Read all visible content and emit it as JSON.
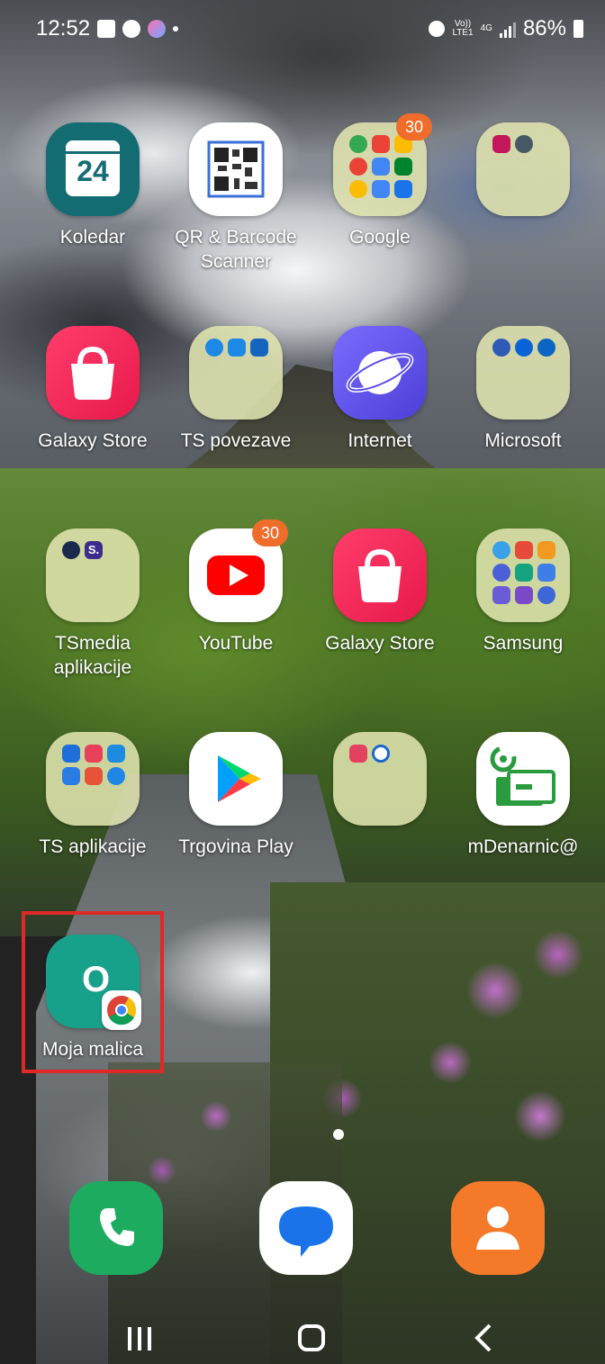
{
  "status_bar": {
    "time": "12:52",
    "network_top": "Vo))",
    "network_bottom": "LTE1",
    "network_type": "4G",
    "battery": "86%",
    "icons": [
      "gallery-icon",
      "chrome-icon",
      "app-icon",
      "alarm-icon",
      "signal-icon",
      "battery-icon"
    ]
  },
  "apps": [
    {
      "label": "Koledar",
      "icon": "calendar-icon",
      "date": "24"
    },
    {
      "label": "QR & Barcode Scanner",
      "icon": "qr-code-icon"
    },
    {
      "label": "Google",
      "icon": "folder-icon",
      "badge": "30"
    },
    {
      "label": "",
      "icon": "folder-icon"
    },
    {
      "label": "Galaxy Store",
      "icon": "shopping-bag-icon"
    },
    {
      "label": "TS povezave",
      "icon": "folder-icon"
    },
    {
      "label": "Internet",
      "icon": "planet-icon"
    },
    {
      "label": "Microsoft",
      "icon": "folder-icon"
    },
    {
      "label": "TSmedia aplikacije",
      "icon": "folder-icon",
      "mini_text": "S."
    },
    {
      "label": "YouTube",
      "icon": "youtube-icon",
      "badge": "30"
    },
    {
      "label": "Galaxy Store",
      "icon": "shopping-bag-icon"
    },
    {
      "label": "Samsung",
      "icon": "folder-icon"
    },
    {
      "label": "TS aplikacije",
      "icon": "folder-icon"
    },
    {
      "label": "Trgovina Play",
      "icon": "play-store-icon"
    },
    {
      "label": "",
      "icon": "folder-icon"
    },
    {
      "label": "mDenarnic@",
      "icon": "wallet-icon"
    },
    {
      "label": "Moja malica",
      "icon": "moja-malica-icon",
      "glyph": "O"
    }
  ],
  "dock": [
    {
      "name": "phone-icon"
    },
    {
      "name": "messages-icon"
    },
    {
      "name": "contacts-icon"
    }
  ],
  "nav": [
    "recents-button",
    "home-button",
    "back-button"
  ],
  "colors": {
    "highlight": "#e02828",
    "badge": "#ef6c2b",
    "folder": "#e0e4ae"
  }
}
